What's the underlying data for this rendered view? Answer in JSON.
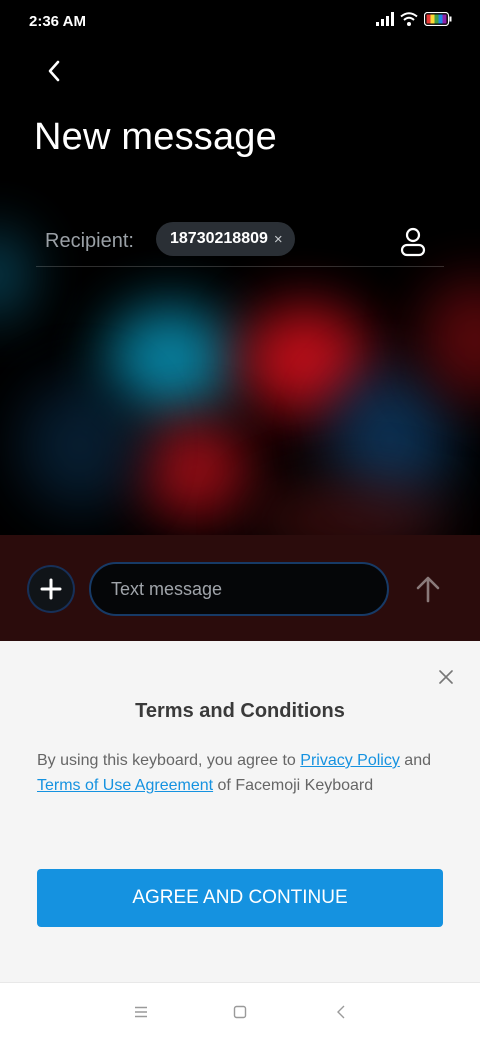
{
  "status_bar": {
    "time": "2:36 AM",
    "icons": [
      "signal-icon",
      "wifi-icon",
      "battery-icon"
    ]
  },
  "header": {
    "back_icon": "chevron-left-icon",
    "title": "New message"
  },
  "recipient": {
    "label": "Recipient:",
    "chip_value": "18730218809",
    "chip_remove": "×",
    "contact_icon": "person-icon"
  },
  "composer": {
    "add_icon": "plus-icon",
    "placeholder": "Text message",
    "send_icon": "arrow-up-icon"
  },
  "terms_sheet": {
    "close_icon": "close-icon",
    "title": "Terms and Conditions",
    "body_prefix": "By using this keyboard, you agree to ",
    "privacy_link": "Privacy Policy",
    "body_middle": " and ",
    "terms_link": "Terms of Use Agreement",
    "body_suffix": " of Facemoji Keyboard",
    "agree_button": "AGREE AND CONTINUE",
    "accent_color": "#1592e0"
  },
  "nav_bar": {
    "items": [
      "menu-icon",
      "home-icon",
      "back-icon"
    ]
  }
}
